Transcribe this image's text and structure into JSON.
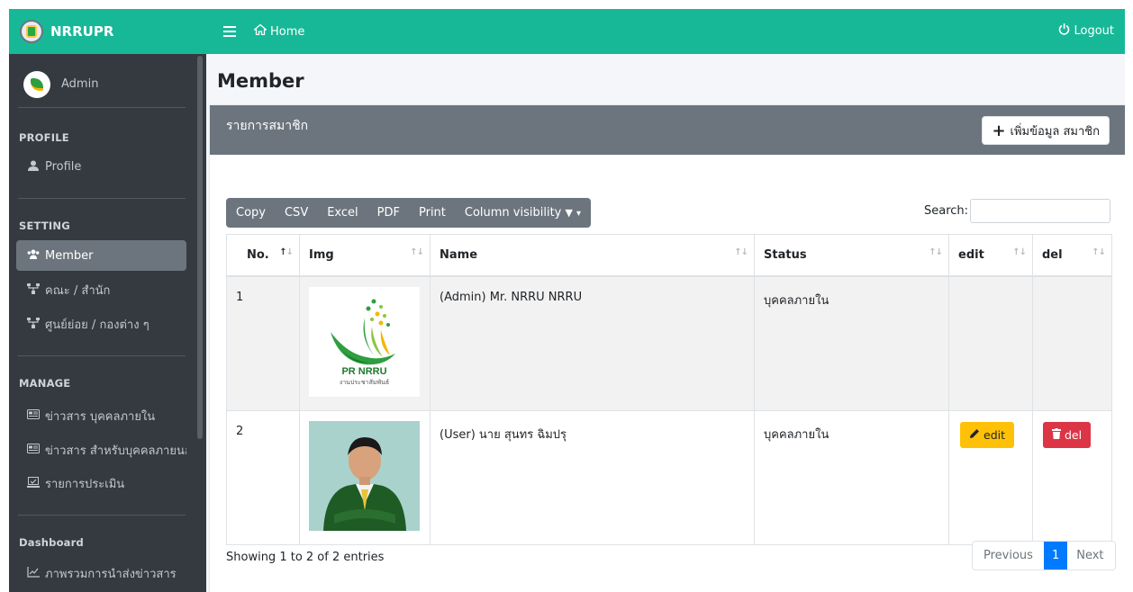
{
  "brand": {
    "name": "NRRUPR"
  },
  "user": {
    "name": "Admin"
  },
  "sidebar": {
    "headers": {
      "profile": "PROFILE",
      "setting": "SETTING",
      "manage": "MANAGE",
      "dashboard": "Dashboard"
    },
    "items": [
      {
        "label": "Profile",
        "icon": "user-icon"
      },
      {
        "label": "Member",
        "icon": "users-icon",
        "active": true
      },
      {
        "label": "คณะ / สำนัก",
        "icon": "sitemap-icon"
      },
      {
        "label": "ศูนย์ย่อย / กองต่าง ๆ",
        "icon": "sitemap-icon"
      },
      {
        "label": "ข่าวสาร บุคคลภายใน",
        "icon": "newspaper-icon"
      },
      {
        "label": "ข่าวสาร สำหรับบุคคลภายนอ",
        "icon": "newspaper-icon"
      },
      {
        "label": "รายการประเมิน",
        "icon": "poll-icon"
      },
      {
        "label": "ภาพรวมการนำส่งข่าวสาร",
        "icon": "chart-line-icon"
      }
    ]
  },
  "topbar": {
    "home_label": "Home",
    "logout_label": "Logout"
  },
  "page": {
    "title": "Member"
  },
  "card": {
    "title": "รายการสมาชิก",
    "add_button": "เพิ่มข้อมูล สมาชิก"
  },
  "toolbar": {
    "copy": "Copy",
    "csv": "CSV",
    "excel": "Excel",
    "pdf": "PDF",
    "print": "Print",
    "column_visibility": "Column visibility"
  },
  "search": {
    "label": "Search:",
    "value": ""
  },
  "table": {
    "columns": [
      "No.",
      "Img",
      "Name",
      "Status",
      "edit",
      "del"
    ],
    "rows": [
      {
        "no": "1",
        "name": "(Admin) Mr. NRRU NRRU",
        "status": "บุคคลภายใน",
        "logo_text": "PR NRRU",
        "logo_subtext": "งานประชาสัมพันธ์"
      },
      {
        "no": "2",
        "name": "(User) นาย สุนทร ฉิมปรุ",
        "status": "บุคคลภายใน",
        "edit": "edit",
        "del": "del"
      }
    ]
  },
  "footer": {
    "info": "Showing 1 to 2 of 2 entries",
    "previous": "Previous",
    "page": "1",
    "next": "Next"
  },
  "colors": {
    "brand_teal": "#17b897",
    "sidebar_dark": "#343a40",
    "card_header": "#6c757d",
    "edit_yellow": "#ffc107",
    "del_red": "#dc3545",
    "page_blue": "#007bff"
  }
}
